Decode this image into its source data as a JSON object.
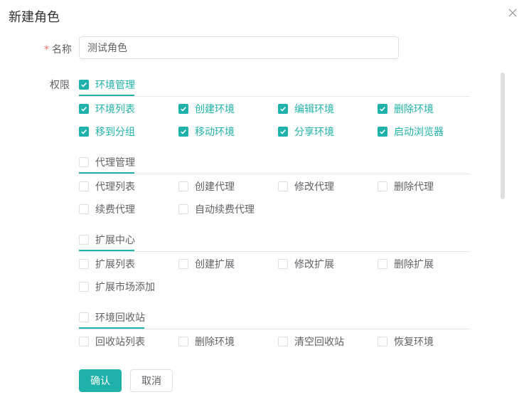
{
  "dialog": {
    "title": "新建角色",
    "close_icon": "close-icon"
  },
  "form": {
    "name_label": "名称",
    "required_mark": "*",
    "name_value": "测试角色",
    "permission_label": "权限"
  },
  "groups": [
    {
      "title": "环境管理",
      "checked": true,
      "items": [
        {
          "label": "环境列表",
          "checked": true
        },
        {
          "label": "创建环境",
          "checked": true
        },
        {
          "label": "编辑环境",
          "checked": true
        },
        {
          "label": "删除环境",
          "checked": true
        },
        {
          "label": "移到分组",
          "checked": true
        },
        {
          "label": "移动环境",
          "checked": true
        },
        {
          "label": "分享环境",
          "checked": true
        },
        {
          "label": "启动浏览器",
          "checked": true
        }
      ]
    },
    {
      "title": "代理管理",
      "checked": false,
      "items": [
        {
          "label": "代理列表",
          "checked": false
        },
        {
          "label": "创建代理",
          "checked": false
        },
        {
          "label": "修改代理",
          "checked": false
        },
        {
          "label": "删除代理",
          "checked": false
        },
        {
          "label": "续费代理",
          "checked": false
        },
        {
          "label": "自动续费代理",
          "checked": false
        }
      ]
    },
    {
      "title": "扩展中心",
      "checked": false,
      "items": [
        {
          "label": "扩展列表",
          "checked": false
        },
        {
          "label": "创建扩展",
          "checked": false
        },
        {
          "label": "修改扩展",
          "checked": false
        },
        {
          "label": "删除扩展",
          "checked": false
        },
        {
          "label": "扩展市场添加",
          "checked": false
        }
      ]
    },
    {
      "title": "环境回收站",
      "checked": false,
      "items": [
        {
          "label": "回收站列表",
          "checked": false
        },
        {
          "label": "删除环境",
          "checked": false
        },
        {
          "label": "清空回收站",
          "checked": false
        },
        {
          "label": "恢复环境",
          "checked": false
        }
      ]
    }
  ],
  "buttons": {
    "confirm": "确认",
    "cancel": "取消"
  },
  "colors": {
    "accent": "#20b2aa",
    "border": "#dcdfe6",
    "required": "#f56c6c"
  }
}
